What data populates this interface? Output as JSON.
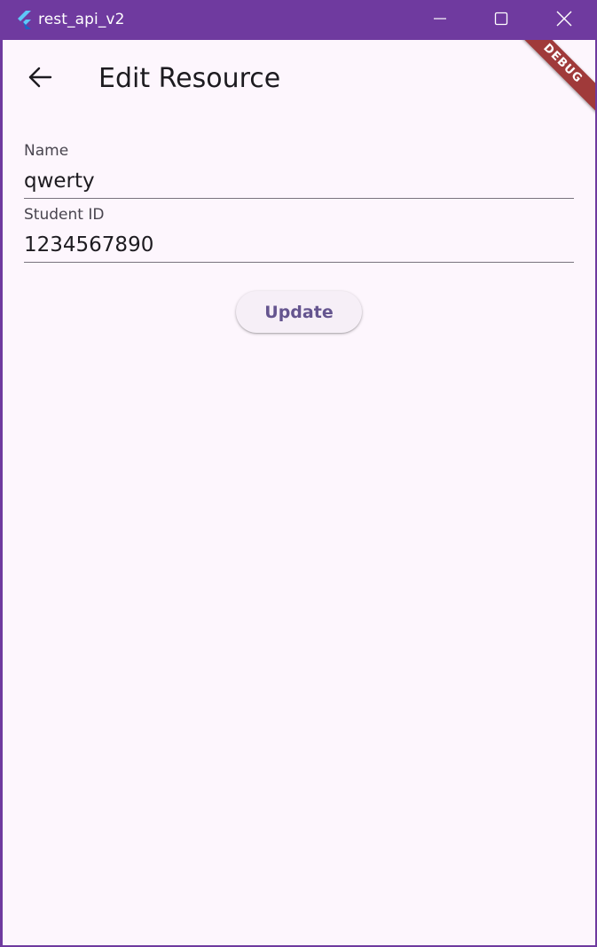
{
  "window": {
    "title": "rest_api_v2",
    "app_icon": "flutter-logo-icon",
    "controls": {
      "minimize_icon": "minimize-icon",
      "maximize_icon": "maximize-icon",
      "close_icon": "close-icon"
    }
  },
  "appbar": {
    "back_icon": "arrow-back-icon",
    "title": "Edit Resource",
    "debug_banner": "DEBUG"
  },
  "form": {
    "name": {
      "label": "Name",
      "value": "qwerty"
    },
    "student_id": {
      "label": "Student ID",
      "value": "1234567890"
    },
    "update_label": "Update"
  },
  "colors": {
    "titlebar": "#6f3a9f",
    "background": "#fdf6fd",
    "button_text": "#65558f",
    "debug_banner": "#a03a3a"
  }
}
